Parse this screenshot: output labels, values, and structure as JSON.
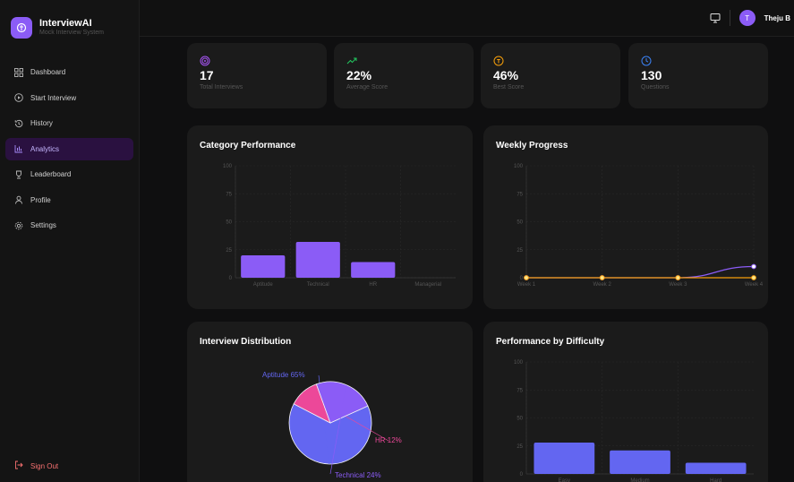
{
  "brand": {
    "name": "InterviewAI",
    "subtitle": "Mock Interview System"
  },
  "nav": [
    {
      "label": "Dashboard",
      "icon": "grid-icon"
    },
    {
      "label": "Start Interview",
      "icon": "play-circle-icon"
    },
    {
      "label": "History",
      "icon": "history-icon"
    },
    {
      "label": "Analytics",
      "icon": "bar-chart-icon",
      "active": true
    },
    {
      "label": "Leaderboard",
      "icon": "trophy-icon"
    },
    {
      "label": "Profile",
      "icon": "user-icon"
    },
    {
      "label": "Settings",
      "icon": "gear-icon"
    }
  ],
  "signout": "Sign Out",
  "user": {
    "initial": "T",
    "name": "Theju B"
  },
  "stats": [
    {
      "value": "17",
      "label": "Total Interviews",
      "icon": "target-icon",
      "color": "#a855f7"
    },
    {
      "value": "22%",
      "label": "Average Score",
      "icon": "trend-up-icon",
      "color": "#22c55e"
    },
    {
      "value": "46%",
      "label": "Best Score",
      "icon": "award-icon",
      "color": "#f59e0b"
    },
    {
      "value": "130",
      "label": "Questions",
      "icon": "clock-icon",
      "color": "#3b82f6"
    }
  ],
  "colors": {
    "accent": "#8b5cf6",
    "bar_blue": "#6366f1",
    "line_orange": "#f59e0b",
    "pie_pink": "#ec4899"
  },
  "chart_data": [
    {
      "type": "bar",
      "title": "Category Performance",
      "categories": [
        "Aptitude",
        "Technical",
        "HR",
        "Managerial"
      ],
      "values": [
        20,
        32,
        14,
        0
      ],
      "ylim": [
        0,
        100
      ],
      "yticks": [
        0,
        25,
        50,
        75,
        100
      ],
      "grid": true
    },
    {
      "type": "line",
      "title": "Weekly Progress",
      "categories": [
        "Week 1",
        "Week 2",
        "Week 3",
        "Week 4"
      ],
      "series": [
        {
          "values": [
            0,
            0,
            0,
            10
          ],
          "color": "#8b5cf6"
        },
        {
          "values": [
            0,
            0,
            0,
            0
          ],
          "color": "#f59e0b"
        }
      ],
      "ylim": [
        0,
        100
      ],
      "yticks": [
        0,
        25,
        50,
        75,
        100
      ],
      "grid": true
    },
    {
      "type": "pie",
      "title": "Interview Distribution",
      "slices": [
        {
          "label": "Aptitude",
          "value": 65,
          "text": "Aptitude 65%",
          "color": "#6366f1"
        },
        {
          "label": "HR",
          "value": 12,
          "text": "HR 12%",
          "color": "#ec4899"
        },
        {
          "label": "Technical",
          "value": 24,
          "text": "Technical 24%",
          "color": "#8b5cf6"
        }
      ]
    },
    {
      "type": "bar",
      "title": "Performance by Difficulty",
      "categories": [
        "Easy",
        "Medium",
        "Hard"
      ],
      "values": [
        28,
        21,
        10
      ],
      "ylim": [
        0,
        100
      ],
      "yticks": [
        0,
        25,
        50,
        75,
        100
      ],
      "grid": true
    }
  ]
}
